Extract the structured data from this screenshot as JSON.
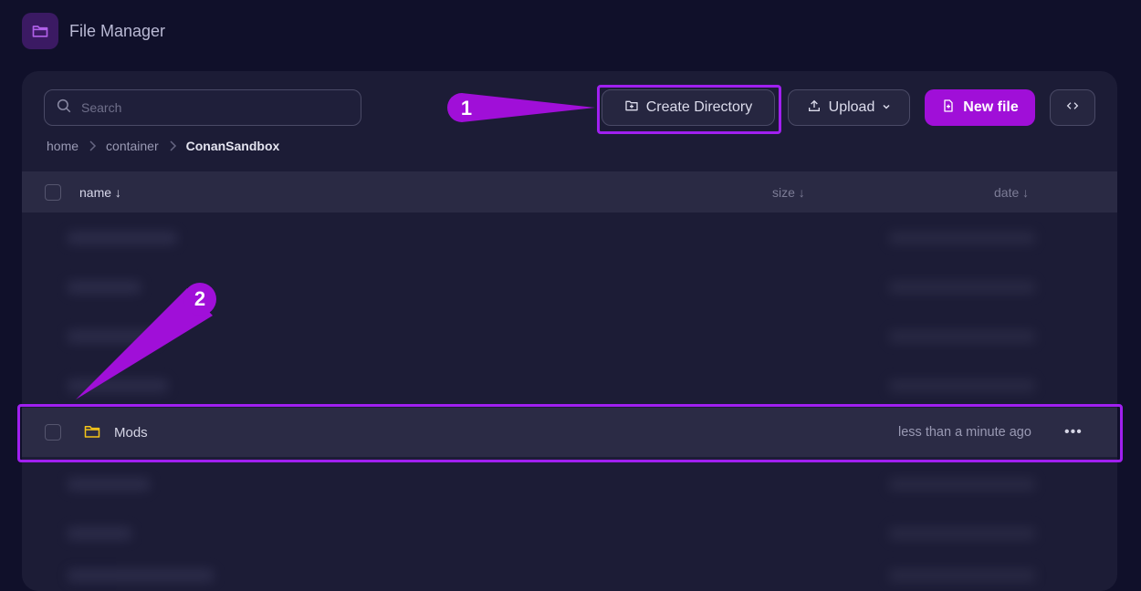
{
  "app": {
    "title": "File Manager"
  },
  "search": {
    "placeholder": "Search",
    "value": ""
  },
  "breadcrumb": {
    "items": [
      "home",
      "container",
      "ConanSandbox"
    ]
  },
  "toolbar": {
    "create_directory_label": "Create Directory",
    "upload_label": "Upload",
    "new_file_label": "New file",
    "code_icon": "code-brackets-icon"
  },
  "table": {
    "columns": {
      "name": "name ↓",
      "size": "size ↓",
      "date": "date ↓"
    },
    "rows": [
      {
        "name": "Mods",
        "type": "folder",
        "size": "",
        "date": "less than a minute ago"
      }
    ]
  },
  "annotations": {
    "callout_1": "1",
    "callout_2": "2"
  },
  "colors": {
    "accent": "#a00fd8",
    "highlight": "#a020f0",
    "background": "#10102a",
    "panel": "#1c1c36",
    "folder": "#f5c518"
  }
}
